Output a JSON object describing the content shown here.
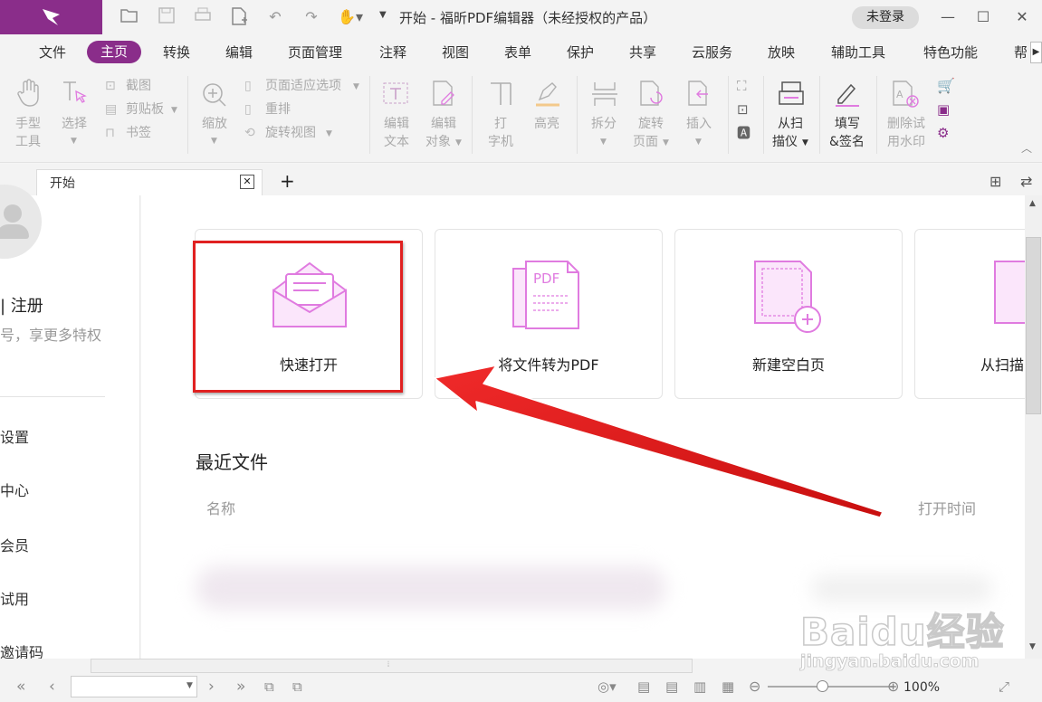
{
  "app": {
    "title": "开始 - 福昕PDF编辑器（未经授权的产品）",
    "login_label": "未登录"
  },
  "menu": {
    "items": [
      "文件",
      "主页",
      "转换",
      "编辑",
      "页面管理",
      "注释",
      "视图",
      "表单",
      "保护",
      "共享",
      "云服务",
      "放映",
      "辅助工具",
      "特色功能",
      "帮"
    ],
    "active": "主页"
  },
  "ribbon": {
    "hand_tool": [
      "手型",
      "工具"
    ],
    "select_tool": [
      "选择"
    ],
    "screenshot": "截图",
    "clipboard": "剪贴板",
    "bookmark": "书签",
    "zoom": "缩放",
    "page_fit": "页面适应选项",
    "reflow": "重排",
    "rotate_view": "旋转视图",
    "edit_text": [
      "编辑",
      "文本"
    ],
    "edit_object": [
      "编辑",
      "对象"
    ],
    "typewriter": [
      "打",
      "字机"
    ],
    "highlight": "高亮",
    "split": "拆分",
    "rotate_page": [
      "旋转",
      "页面"
    ],
    "insert": "插入",
    "from_scanner": [
      "从扫",
      "描仪"
    ],
    "fill_sign": [
      "填写",
      "&签名"
    ],
    "remove_watermark": [
      "删除试",
      "用水印"
    ]
  },
  "tabs": {
    "doc_tab": "开始",
    "add": "+"
  },
  "sidebar": {
    "register": "|  注册",
    "promo": "号，享更多特权",
    "items": [
      "设置",
      "中心",
      "会员",
      "试用",
      "邀请码"
    ]
  },
  "main": {
    "cards": [
      "快速打开",
      "将文件转为PDF",
      "新建空白页",
      "从扫描"
    ],
    "recent_title": "最近文件",
    "col_name": "名称",
    "col_time": "打开时间"
  },
  "status": {
    "zoom": "100%"
  },
  "watermark": {
    "brand": "Baidu经验",
    "url": "jingyan.baidu.com"
  },
  "colors": {
    "brand": "#8a2d8a",
    "accent_pink": "#e07be0",
    "annotation_red": "#e02020"
  }
}
